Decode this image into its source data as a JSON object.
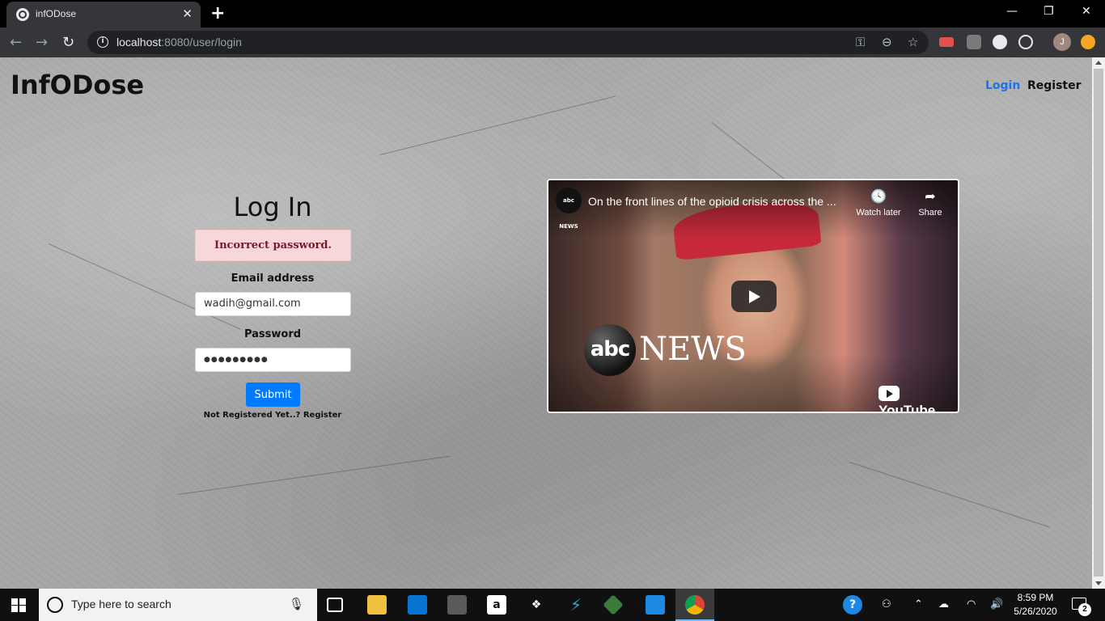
{
  "browser": {
    "tab_title": "infODose",
    "tab_close": "✕",
    "new_tab": "+",
    "url_host": "localhost",
    "url_rest": ":8080/user/login",
    "profile_initial": "J",
    "window_controls": {
      "minimize": "—",
      "restore": "❐",
      "close": "✕"
    },
    "nav": {
      "back": "←",
      "forward": "→",
      "reload": "↻"
    },
    "omni_icons": {
      "key": "⚿",
      "zoom": "⊖",
      "star": "☆"
    }
  },
  "site": {
    "brand": "InfODose",
    "nav_login": "Login",
    "nav_register": "Register"
  },
  "login": {
    "title": "Log In",
    "alert": "Incorrect password.",
    "email_label": "Email address",
    "email_value": "wadih@gmail.com",
    "password_label": "Password",
    "password_value": "●●●●●●●●●",
    "submit_label": "Submit",
    "register_link": "Not Registered Yet..? Register"
  },
  "video": {
    "channel": "abc NEWS",
    "title": "On the front lines of the opioid crisis across the ...",
    "watch_later_icon": "🕓",
    "watch_later": "Watch later",
    "share_icon": "➦",
    "share": "Share",
    "abc_logo": "abc",
    "abc_news": "NEWS",
    "youtube": "YouTube"
  },
  "taskbar": {
    "search_placeholder": "Type here to search",
    "mic": "🎙",
    "time": "8:59 PM",
    "date": "5/26/2020",
    "notification_count": "2"
  }
}
